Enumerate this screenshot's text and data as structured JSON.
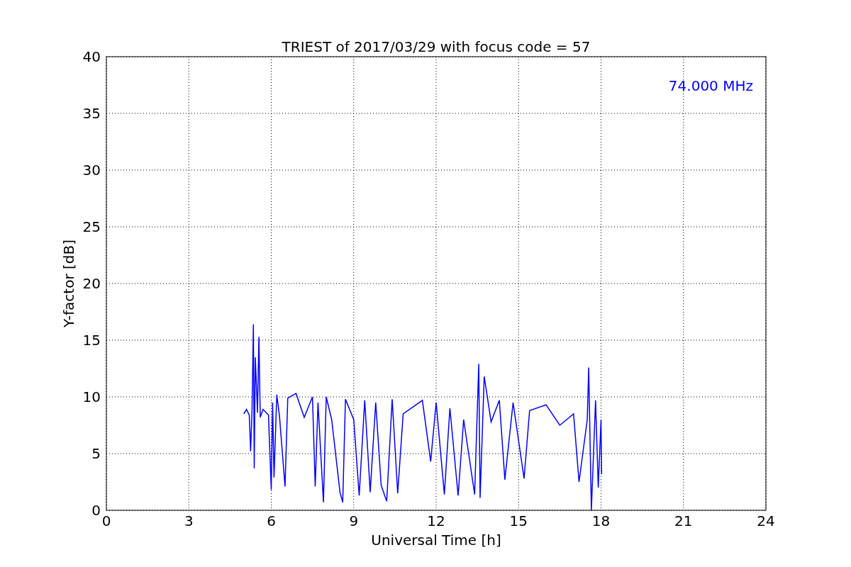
{
  "chart_data": {
    "type": "line",
    "title": "TRIEST of 2017/03/29 with focus code = 57",
    "xlabel": "Universal Time [h]",
    "ylabel": "Y-factor [dB]",
    "xlim": [
      0,
      24
    ],
    "ylim": [
      0,
      40
    ],
    "xticks": [
      0,
      3,
      6,
      9,
      12,
      15,
      18,
      21,
      24
    ],
    "yticks": [
      0,
      5,
      10,
      15,
      20,
      25,
      30,
      35,
      40
    ],
    "x": [
      5.0,
      5.1,
      5.2,
      5.25,
      5.3,
      5.35,
      5.38,
      5.42,
      5.5,
      5.55,
      5.6,
      5.7,
      5.9,
      6.0,
      6.05,
      6.1,
      6.2,
      6.3,
      6.5,
      6.6,
      6.9,
      7.2,
      7.5,
      7.6,
      7.7,
      7.9,
      8.0,
      8.2,
      8.5,
      8.6,
      8.7,
      9.0,
      9.2,
      9.4,
      9.6,
      9.8,
      10.0,
      10.2,
      10.4,
      10.6,
      10.8,
      11.5,
      11.8,
      12.0,
      12.3,
      12.5,
      12.8,
      13.0,
      13.4,
      13.55,
      13.6,
      13.75,
      14.0,
      14.3,
      14.5,
      14.8,
      15.2,
      15.4,
      16.0,
      16.5,
      17.0,
      17.2,
      17.5,
      17.55,
      17.65,
      17.8,
      17.9,
      18.0,
      18.02
    ],
    "series": [
      {
        "name": "74.000 MHz",
        "color": "#0000ff",
        "values": [
          8.5,
          8.9,
          8.4,
          5.2,
          8.8,
          16.4,
          3.7,
          13.5,
          8.6,
          15.3,
          8.2,
          8.9,
          8.4,
          1.8,
          9.5,
          2.9,
          10.2,
          8.3,
          2.1,
          9.9,
          10.3,
          8.2,
          10.0,
          2.1,
          9.5,
          0.7,
          10.0,
          8.0,
          1.6,
          0.7,
          9.8,
          8.0,
          1.3,
          9.7,
          1.6,
          9.5,
          2.2,
          0.8,
          9.8,
          1.5,
          8.5,
          9.7,
          4.3,
          9.5,
          1.4,
          9.0,
          1.3,
          8.0,
          1.4,
          12.9,
          1.1,
          11.8,
          7.8,
          9.7,
          2.7,
          9.5,
          2.8,
          8.8,
          9.3,
          7.5,
          8.5,
          2.5,
          8.0,
          12.6,
          0.0,
          9.7,
          2.0,
          8.0,
          3.2
        ]
      }
    ],
    "grid": true
  }
}
